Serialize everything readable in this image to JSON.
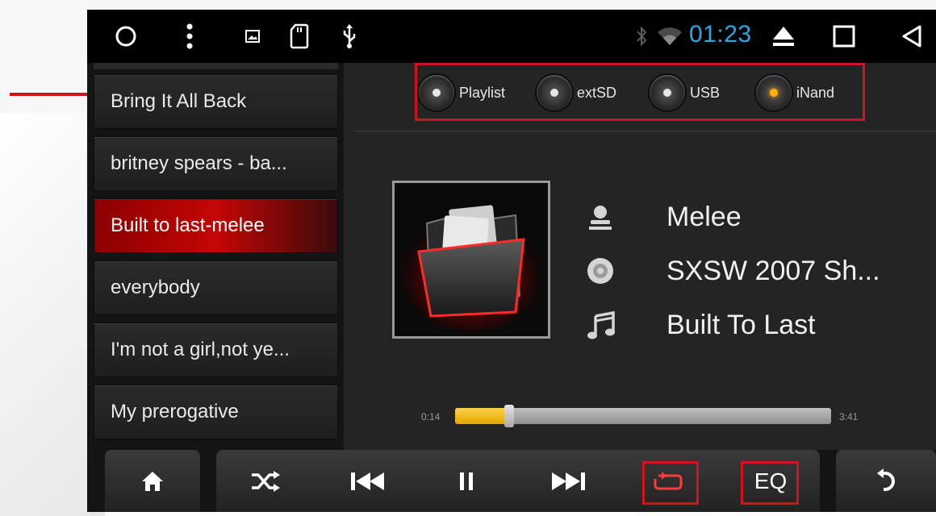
{
  "statusbar": {
    "time": "01:23",
    "icons": [
      "circle-home-icon",
      "menu-dots-icon",
      "image-icon",
      "sdcard-icon",
      "usb-icon",
      "bluetooth-icon",
      "wifi-icon",
      "eject-icon",
      "square-recent-icon",
      "back-triangle-icon"
    ]
  },
  "playlist": {
    "items": [
      {
        "label": "Bring It All Back",
        "active": false
      },
      {
        "label": "britney spears - ba...",
        "active": false
      },
      {
        "label": "Built to last-melee",
        "active": true
      },
      {
        "label": "everybody",
        "active": false
      },
      {
        "label": "I'm not a girl,not ye...",
        "active": false
      },
      {
        "label": "My prerogative",
        "active": false
      }
    ]
  },
  "sources": [
    {
      "label": "Playlist",
      "selected": false
    },
    {
      "label": "extSD",
      "selected": false
    },
    {
      "label": "USB",
      "selected": false
    },
    {
      "label": "iNand",
      "selected": true
    }
  ],
  "now_playing": {
    "artist": "Melee",
    "album": "SXSW 2007 Sh...",
    "title": "Built To Last",
    "current_time": "0:14",
    "total_time": "3:41",
    "progress_fraction": 0.08
  },
  "controls": {
    "eq_label": "EQ"
  },
  "colors": {
    "accent_time": "#2aa8df",
    "highlight_red": "#d3121f",
    "progress_yellow": "#f5be1a"
  }
}
